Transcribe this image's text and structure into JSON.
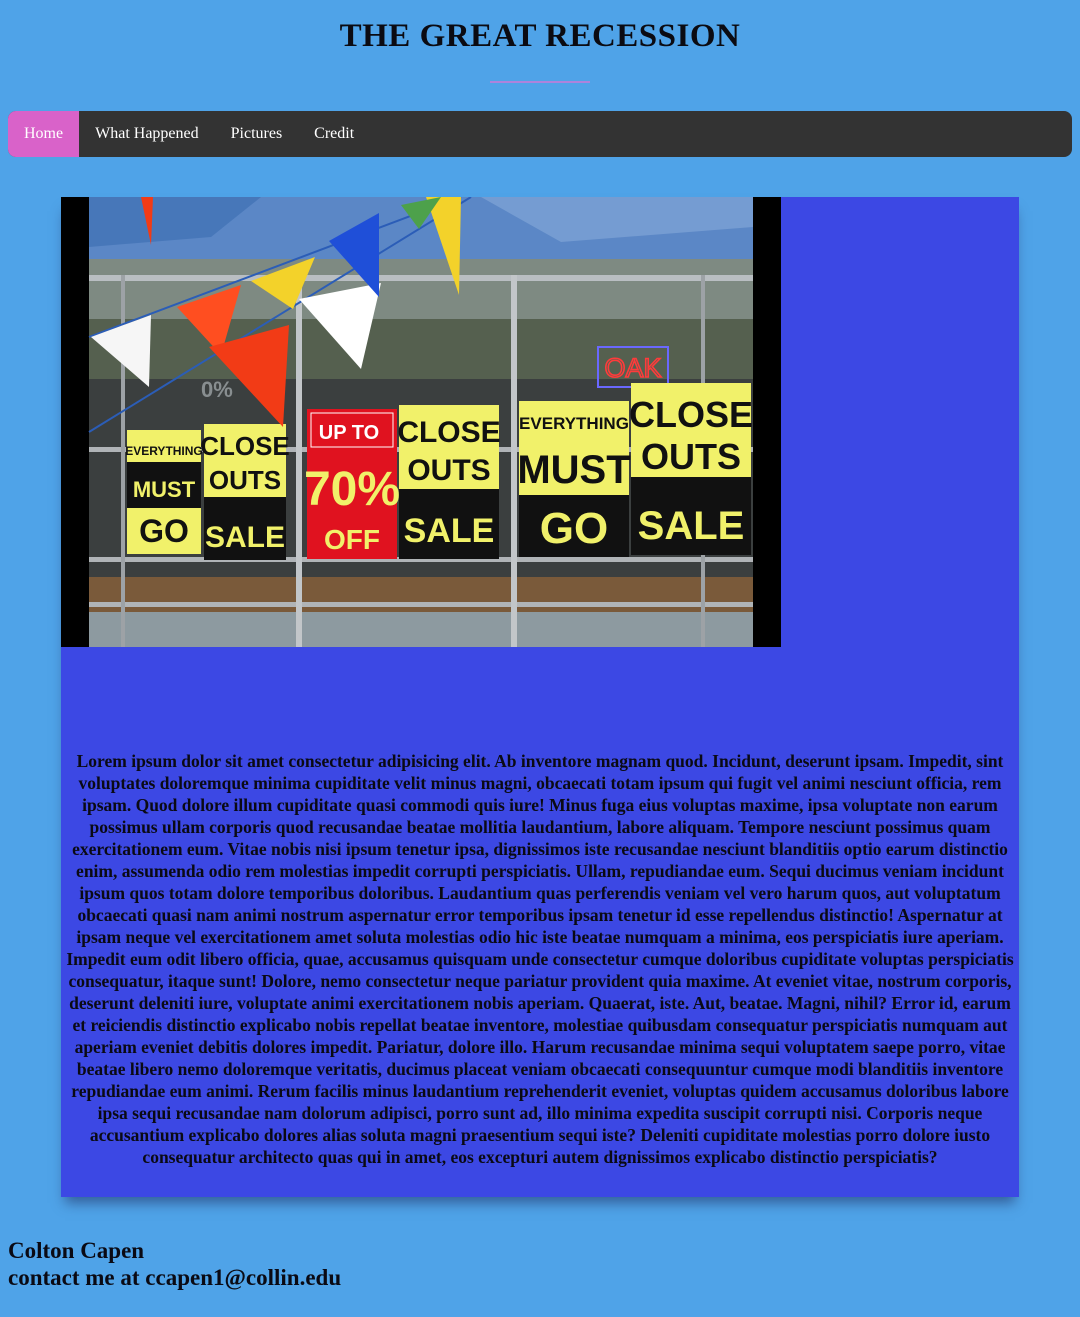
{
  "header": {
    "title": "THE GREAT RECESSION"
  },
  "nav": {
    "items": [
      {
        "label": "Home",
        "active": true
      },
      {
        "label": "What Happened",
        "active": false
      },
      {
        "label": "Pictures",
        "active": false
      },
      {
        "label": "Credit",
        "active": false
      }
    ]
  },
  "photo": {
    "signs": {
      "s1": {
        "top": "EVERYTHING",
        "mid": "MUST",
        "bot": "GO"
      },
      "s2": {
        "a": "CLOSE",
        "b": "OUTS",
        "c": "SALE"
      },
      "s3": {
        "a": "UP TO",
        "b": "70%",
        "c": "OFF"
      },
      "s4": {
        "a": "CLOSE",
        "b": "OUTS",
        "c": "SALE"
      },
      "s5": {
        "top": "EVERYTHING",
        "mid": "MUST",
        "bot": "GO"
      },
      "s6": {
        "a": "CLOSE",
        "b": "OUTS",
        "c": "SALE"
      },
      "neon": "OAK",
      "glass": "0%"
    }
  },
  "main": {
    "body": "Lorem ipsum dolor sit amet consectetur adipisicing elit. Ab inventore magnam quod. Incidunt, deserunt ipsam. Impedit, sint voluptates doloremque minima cupiditate velit minus magni, obcaecati totam ipsum qui fugit vel animi nesciunt officia, rem ipsam. Quod dolore illum cupiditate quasi commodi quis iure! Minus fuga eius voluptas maxime, ipsa voluptate non earum possimus ullam corporis quod recusandae beatae mollitia laudantium, labore aliquam. Tempore nesciunt possimus quam exercitationem eum. Vitae nobis nisi ipsum tenetur ipsa, dignissimos iste recusandae nesciunt blanditiis optio earum distinctio enim, assumenda odio rem molestias impedit corrupti perspiciatis. Ullam, repudiandae eum. Sequi ducimus veniam incidunt ipsum quos totam dolore temporibus doloribus. Laudantium quas perferendis veniam vel vero harum quos, aut voluptatum obcaecati quasi nam animi nostrum aspernatur error temporibus ipsam tenetur id esse repellendus distinctio! Aspernatur at ipsam neque vel exercitationem amet soluta molestias odio hic iste beatae numquam a minima, eos perspiciatis iure aperiam. Impedit eum odit libero officia, quae, accusamus quisquam unde consectetur cumque doloribus cupiditate voluptas perspiciatis consequatur, itaque sunt! Dolore, nemo consectetur neque pariatur provident quia maxime. At eveniet vitae, nostrum corporis, deserunt deleniti iure, voluptate animi exercitationem nobis aperiam. Quaerat, iste. Aut, beatae. Magni, nihil? Error id, earum et reiciendis distinctio explicabo nobis repellat beatae inventore, molestiae quibusdam consequatur perspiciatis numquam aut aperiam eveniet debitis dolores impedit. Pariatur, dolore illo. Harum recusandae minima sequi voluptatem saepe porro, vitae beatae libero nemo doloremque veritatis, ducimus placeat veniam obcaecati consequuntur cumque modi blanditiis inventore repudiandae eum animi. Rerum facilis minus laudantium reprehenderit eveniet, voluptas quidem accusamus doloribus labore ipsa sequi recusandae nam dolorum adipisci, porro sunt ad, illo minima expedita suscipit corrupti nisi. Corporis neque accusantium explicabo dolores alias soluta magni praesentium sequi iste? Deleniti cupiditate molestias porro dolore iusto consequatur architecto quas qui in amet, eos excepturi autem dignissimos explicabo distinctio perspiciatis?"
  },
  "footer": {
    "name": "Colton Capen",
    "contact": "contact me at ccapen1@collin.edu"
  },
  "colors": {
    "page_bg": "#4fa3e8",
    "nav_bg": "#333333",
    "nav_active": "#d962c9",
    "content_bg": "#3c48e4",
    "sign_yellow": "#f1f16a",
    "sign_red": "#e0121f"
  }
}
